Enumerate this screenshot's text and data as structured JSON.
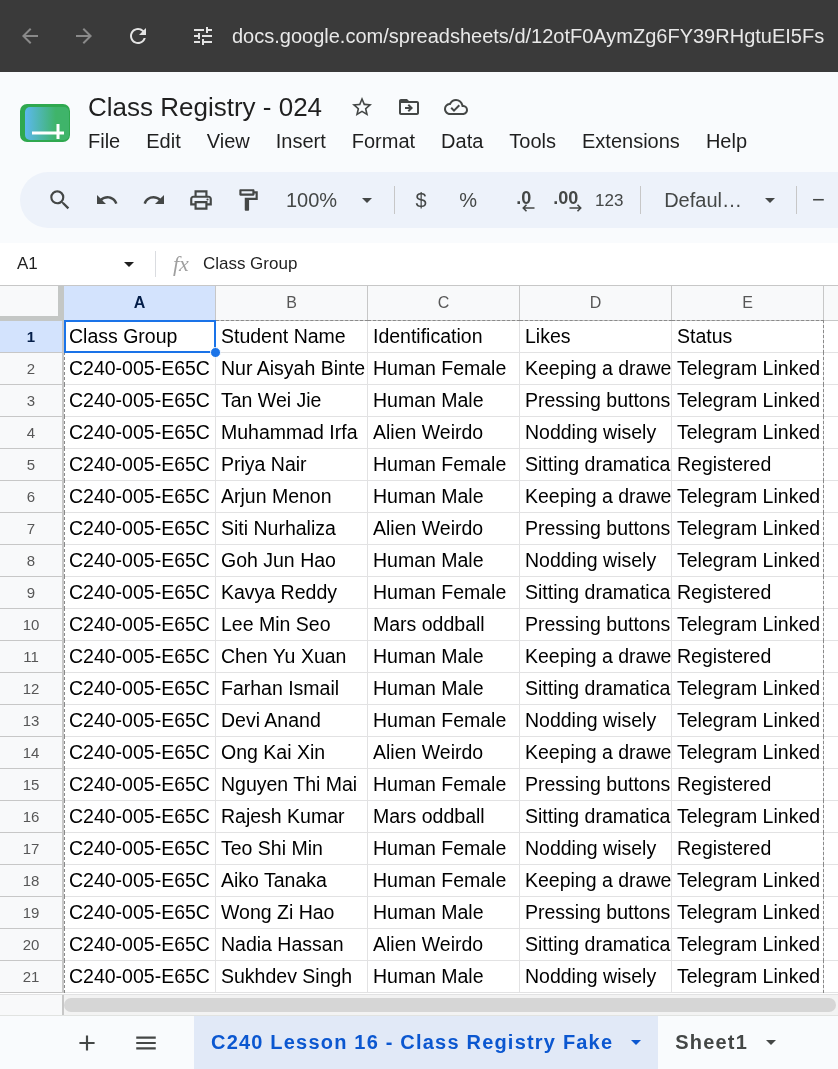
{
  "browser": {
    "url": "docs.google.com/spreadsheets/d/12otF0AymZg6FY39RHgtuEI5Fs",
    "back_disabled": true,
    "forward_disabled": true
  },
  "document": {
    "title": "Class Registry - 024",
    "starred": false
  },
  "menu": [
    "File",
    "Edit",
    "View",
    "Insert",
    "Format",
    "Data",
    "Tools",
    "Extensions",
    "Help"
  ],
  "toolbar": {
    "zoom": "100%",
    "buttons": [
      {
        "kind": "plain",
        "label": "$"
      },
      {
        "kind": "plain",
        "label": "%"
      },
      {
        "kind": "decrease",
        "label": ".0"
      },
      {
        "kind": "increase",
        "label": ".00"
      },
      {
        "kind": "small",
        "label": "123"
      }
    ],
    "font": "Defaul…",
    "font_size_decrease": "−"
  },
  "formula_bar": {
    "name_box": "A1",
    "function_label": "fx",
    "formula": "Class Group"
  },
  "grid": {
    "copied_range": true,
    "columns": [
      {
        "label": "A",
        "selected": true
      },
      {
        "label": "B",
        "selected": false
      },
      {
        "label": "C",
        "selected": false
      },
      {
        "label": "D",
        "selected": false
      },
      {
        "label": "E",
        "selected": false
      }
    ],
    "rows": [
      {
        "number": "1",
        "selected": true,
        "cells": [
          "Class Group",
          "Student Name",
          "Identification",
          "Likes",
          "Status"
        ]
      },
      {
        "number": "2",
        "selected": false,
        "cells": [
          "C240-005-E65C",
          "Nur Aisyah Binte",
          "Human Female",
          "Keeping a drawe",
          "Telegram Linked"
        ]
      },
      {
        "number": "3",
        "selected": false,
        "cells": [
          "C240-005-E65C",
          "Tan Wei Jie",
          "Human Male",
          "Pressing buttons",
          "Telegram Linked"
        ]
      },
      {
        "number": "4",
        "selected": false,
        "cells": [
          "C240-005-E65C",
          "Muhammad Irfa",
          "Alien Weirdo",
          "Nodding wisely",
          "Telegram Linked"
        ]
      },
      {
        "number": "5",
        "selected": false,
        "cells": [
          "C240-005-E65C",
          "Priya Nair",
          "Human Female",
          "Sitting dramatica",
          "Registered"
        ]
      },
      {
        "number": "6",
        "selected": false,
        "cells": [
          "C240-005-E65C",
          "Arjun Menon",
          "Human Male",
          "Keeping a drawe",
          "Telegram Linked"
        ]
      },
      {
        "number": "7",
        "selected": false,
        "cells": [
          "C240-005-E65C",
          "Siti Nurhaliza",
          "Alien Weirdo",
          "Pressing buttons",
          "Telegram Linked"
        ]
      },
      {
        "number": "8",
        "selected": false,
        "cells": [
          "C240-005-E65C",
          "Goh Jun Hao",
          "Human Male",
          "Nodding wisely",
          "Telegram Linked"
        ]
      },
      {
        "number": "9",
        "selected": false,
        "cells": [
          "C240-005-E65C",
          "Kavya Reddy",
          "Human Female",
          "Sitting dramatica",
          "Registered"
        ]
      },
      {
        "number": "10",
        "selected": false,
        "cells": [
          "C240-005-E65C",
          "Lee Min Seo",
          "Mars oddball",
          "Pressing buttons",
          "Telegram Linked"
        ]
      },
      {
        "number": "11",
        "selected": false,
        "cells": [
          "C240-005-E65C",
          "Chen Yu Xuan",
          "Human Male",
          "Keeping a drawe",
          "Registered"
        ]
      },
      {
        "number": "12",
        "selected": false,
        "cells": [
          "C240-005-E65C",
          "Farhan Ismail",
          "Human Male",
          "Sitting dramatica",
          "Telegram Linked"
        ]
      },
      {
        "number": "13",
        "selected": false,
        "cells": [
          "C240-005-E65C",
          "Devi Anand",
          "Human Female",
          "Nodding wisely",
          "Telegram Linked"
        ]
      },
      {
        "number": "14",
        "selected": false,
        "cells": [
          "C240-005-E65C",
          "Ong Kai Xin",
          "Alien Weirdo",
          "Keeping a drawe",
          "Telegram Linked"
        ]
      },
      {
        "number": "15",
        "selected": false,
        "cells": [
          "C240-005-E65C",
          "Nguyen Thi Mai",
          "Human Female",
          "Pressing buttons",
          "Registered"
        ]
      },
      {
        "number": "16",
        "selected": false,
        "cells": [
          "C240-005-E65C",
          "Rajesh Kumar",
          "Mars oddball",
          "Sitting dramatica",
          "Telegram Linked"
        ]
      },
      {
        "number": "17",
        "selected": false,
        "cells": [
          "C240-005-E65C",
          "Teo Shi Min",
          "Human Female",
          "Nodding wisely",
          "Registered"
        ]
      },
      {
        "number": "18",
        "selected": false,
        "cells": [
          "C240-005-E65C",
          "Aiko Tanaka",
          "Human Female",
          "Keeping a drawe",
          "Telegram Linked"
        ]
      },
      {
        "number": "19",
        "selected": false,
        "cells": [
          "C240-005-E65C",
          "Wong Zi Hao",
          "Human Male",
          "Pressing buttons",
          "Telegram Linked"
        ]
      },
      {
        "number": "20",
        "selected": false,
        "cells": [
          "C240-005-E65C",
          "Nadia Hassan",
          "Alien Weirdo",
          "Sitting dramatica",
          "Telegram Linked"
        ]
      },
      {
        "number": "21",
        "selected": false,
        "cells": [
          "C240-005-E65C",
          "Sukhdev Singh",
          "Human Male",
          "Nodding wisely",
          "Telegram Linked"
        ]
      }
    ]
  },
  "sheet_tabs": [
    {
      "label": "C240 Lesson 16 - Class Registry Fake",
      "selected": true
    },
    {
      "label": "Sheet1",
      "selected": false
    }
  ]
}
